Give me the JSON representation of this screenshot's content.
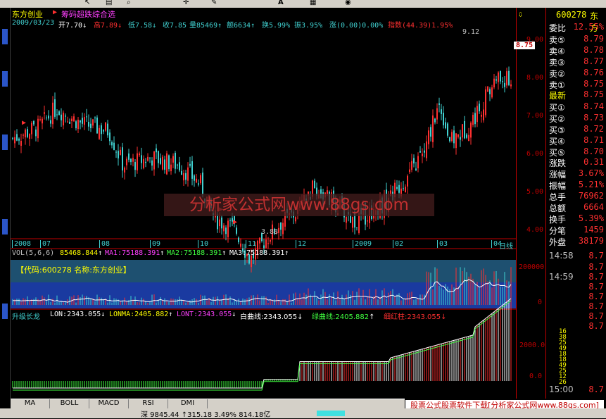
{
  "toolbar": {
    "icons": [
      "arrow-icon",
      "chart-icon",
      "zoom-icon",
      "cursor-icon",
      "text-icon",
      "pen-icon",
      "grid-icon",
      "palette-icon"
    ],
    "text_tool": "A"
  },
  "header": {
    "stock_name": "东方创业",
    "indicator_name": "筹码超跌综合选",
    "date": "2009/03/23",
    "open_label": "开",
    "open": "7.70",
    "high_label": "高",
    "high": "7.89",
    "low_label": "低",
    "low": "7.58",
    "close_label": "收",
    "close": "7.85",
    "vol_label": "量",
    "vol": "85469",
    "amount_label": "额",
    "amount": "6634",
    "turnover_label": "换",
    "turnover": "5.99%",
    "amplitude_label": "振",
    "amplitude": "3.95%",
    "change_label": "涨",
    "change": "(0.00)0.00%",
    "index_label": "指数",
    "index": "(44.39)1.95%"
  },
  "price_axis": [
    "9.00",
    "8.00",
    "7.00",
    "6.00",
    "5.00",
    "4.00"
  ],
  "price_annotations": {
    "high": "9.12",
    "low": "3.88",
    "current": "8.75"
  },
  "time_axis": [
    "2008",
    "07",
    "08",
    "09",
    "10",
    "11",
    "12",
    "2009",
    "02",
    "03",
    "04"
  ],
  "time_axis_unit": "日线",
  "volume": {
    "title": "VOL(5,6,6)",
    "value": "85468.844",
    "ma1_label": "MA1:",
    "ma1": "75188.391",
    "ma2_label": "MA2:",
    "ma2": "75188.391",
    "ma3_label": "MA3:",
    "ma3": "75188.391",
    "info": "【代码:600278 名称:东方创业】",
    "axis": [
      "200000",
      "0"
    ]
  },
  "indicator": {
    "title": "升级长龙",
    "lon": "LON:2343.055",
    "lonma": "LONMA:2405.882",
    "lont": "LONT:2343.055",
    "white": "白曲线:2343.055",
    "green": "绿曲线:2405.882",
    "red": "细红柱:2343.055",
    "axis": [
      "2000.0",
      "0.0"
    ]
  },
  "quote_panel": {
    "code": "600278",
    "name": "东方",
    "ratio_label": "委比",
    "ratio": "12.55%",
    "asks": [
      {
        "label": "卖⑤",
        "price": "8.79"
      },
      {
        "label": "卖④",
        "price": "8.78"
      },
      {
        "label": "卖③",
        "price": "8.77"
      },
      {
        "label": "卖②",
        "price": "8.76"
      },
      {
        "label": "卖①",
        "price": "8.75"
      }
    ],
    "latest_label": "最新",
    "latest": "8.75",
    "bids": [
      {
        "label": "买①",
        "price": "8.74"
      },
      {
        "label": "买②",
        "price": "8.73"
      },
      {
        "label": "买③",
        "price": "8.72"
      },
      {
        "label": "买④",
        "price": "8.71"
      },
      {
        "label": "买⑤",
        "price": "8.70"
      }
    ],
    "stats": [
      {
        "label": "涨跌",
        "value": "0.31"
      },
      {
        "label": "涨幅",
        "value": "3.67%"
      },
      {
        "label": "振幅",
        "value": "5.21%"
      },
      {
        "label": "总手",
        "value": "76962"
      },
      {
        "label": "总额",
        "value": "6664"
      },
      {
        "label": "换手",
        "value": "5.39%"
      },
      {
        "label": "分笔",
        "value": "1459"
      }
    ],
    "outer_label": "外盘",
    "outer": "38179",
    "ticks": [
      {
        "time": "14:58",
        "price": "8.7"
      },
      {
        "time": "",
        "price": "8.7"
      },
      {
        "time": "14:59",
        "price": "8.7"
      },
      {
        "time": "",
        "price": "8.7"
      },
      {
        "time": "",
        "price": "8.7"
      },
      {
        "time": "",
        "price": "8.7"
      },
      {
        "time": "",
        "price": "8.7"
      },
      {
        "time": "",
        "price": "8.7"
      }
    ],
    "tick_vols": [
      "16",
      "38",
      "25",
      "49",
      "18",
      "18",
      "49",
      "25",
      "12",
      "26"
    ],
    "close_time": "15:00",
    "close_price": "8.7"
  },
  "watermark": "分析家公式网www.88gs.com",
  "tabs": [
    "MA",
    "BOLL",
    "MACD",
    "RSI",
    "DMI"
  ],
  "status": {
    "text": "深 9845.44 ↑315.18 3.49% 814.18亿"
  },
  "promo": "股票公式股票软件下载[分析家公式网www.88gs.com]",
  "colors": {
    "up": "#ff3030",
    "down": "#40d0d0",
    "yellow": "#ffff00",
    "panel_border": "#c00000"
  }
}
